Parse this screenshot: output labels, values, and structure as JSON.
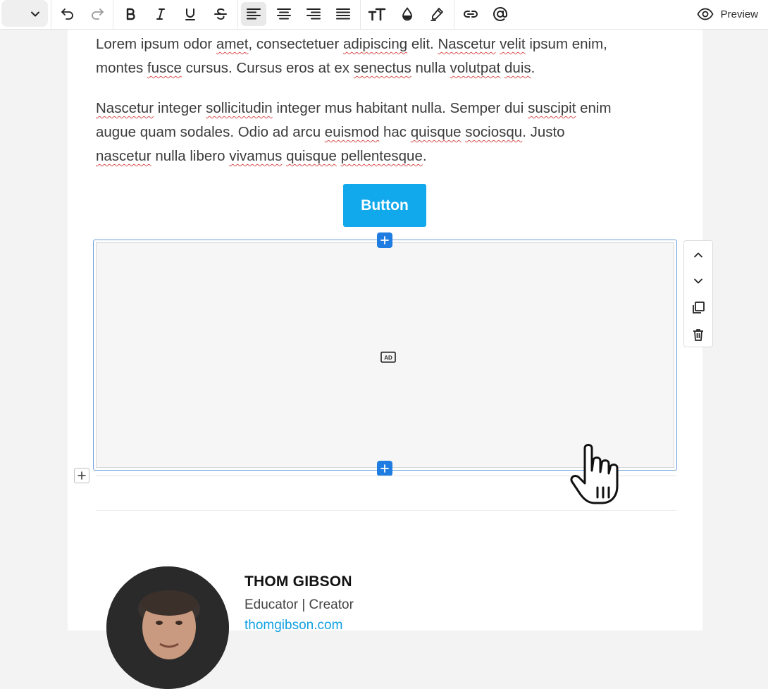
{
  "toolbar": {
    "block_type_value": "",
    "buttons": [
      "undo",
      "redo",
      "bold",
      "italic",
      "underline",
      "strikethrough",
      "align-left",
      "align-center",
      "align-right",
      "align-justify",
      "font-size",
      "color",
      "highlight",
      "link",
      "mention"
    ],
    "active_button": "align-left",
    "preview_label": "Preview"
  },
  "content": {
    "paragraph1": {
      "l1": [
        "Lorem ipsum odor ",
        "amet",
        ", consectetuer ",
        "adipiscing",
        " elit. ",
        "Nascetur",
        " ",
        "velit",
        " ipsum enim,"
      ],
      "l2": [
        "montes ",
        "fusce",
        " cursus. Cursus eros at ex ",
        "senectus",
        " nulla ",
        "volutpat",
        " ",
        "duis",
        "."
      ]
    },
    "paragraph2": {
      "l1": [
        "Nascetur",
        " integer ",
        "sollicitudin",
        " integer mus habitant nulla. Semper dui ",
        "suscipit",
        " enim"
      ],
      "l2": [
        "augue quam sodales. Odio ad arcu ",
        "euismod",
        " hac ",
        "quisque",
        " ",
        "sociosqu",
        ". Justo"
      ],
      "l3": [
        "nascetur",
        " nulla libero ",
        "vivamus",
        " ",
        "quisque",
        " ",
        "pellentesque",
        "."
      ]
    },
    "button_label": "Button",
    "ad_block": {
      "icon": "ad-icon",
      "icon_text": "AD"
    }
  },
  "author": {
    "name": "THOM GIBSON",
    "role": "Educator | Creator",
    "link": "thomgibson.com"
  },
  "colors": {
    "accent": "#12a9ec",
    "selection": "#1f7ce0",
    "spellcheck": "#d9534f"
  }
}
